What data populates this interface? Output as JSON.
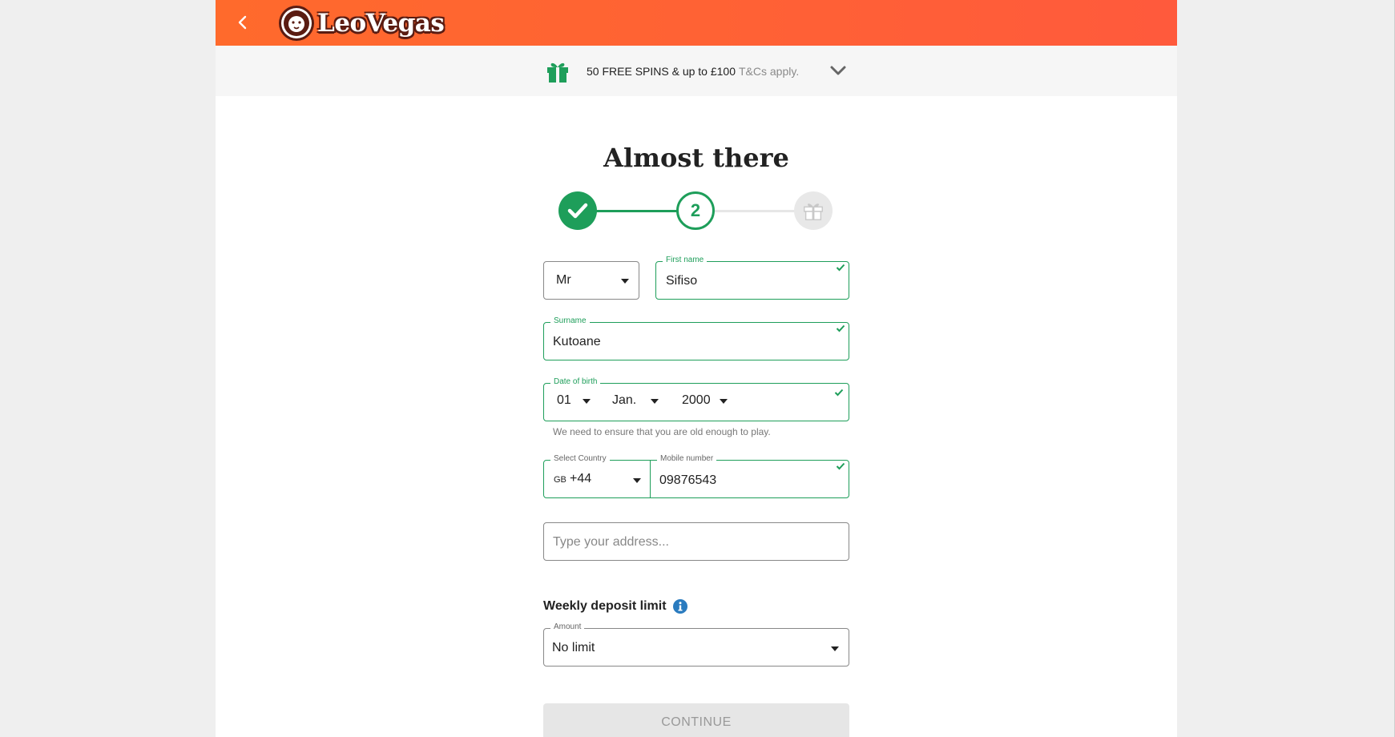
{
  "header": {
    "logo_text": "LeoVegas",
    "brand_color": "#ff6a2c"
  },
  "promo": {
    "text": "50 FREE SPINS & up to £100",
    "tc": "T&Cs apply."
  },
  "page_title": "Almost there",
  "stepper": {
    "current_step": "2",
    "accent": "#1e9e5a"
  },
  "form": {
    "title_value": "Mr",
    "first_name": {
      "label": "First name",
      "value": "Sifiso"
    },
    "surname": {
      "label": "Surname",
      "value": "Kutoane"
    },
    "dob": {
      "label": "Date of birth",
      "day": "01",
      "month": "Jan.",
      "year": "2000",
      "hint": "We need to ensure that you are old enough to play."
    },
    "country": {
      "label": "Select Country",
      "code": "GB",
      "dial": "+44"
    },
    "mobile": {
      "label": "Mobile number",
      "value": "09876543"
    },
    "address": {
      "placeholder": "Type your address..."
    },
    "deposit": {
      "section_label": "Weekly deposit limit",
      "amount_label": "Amount",
      "amount_value": "No limit"
    },
    "continue_label": "CONTINUE"
  }
}
